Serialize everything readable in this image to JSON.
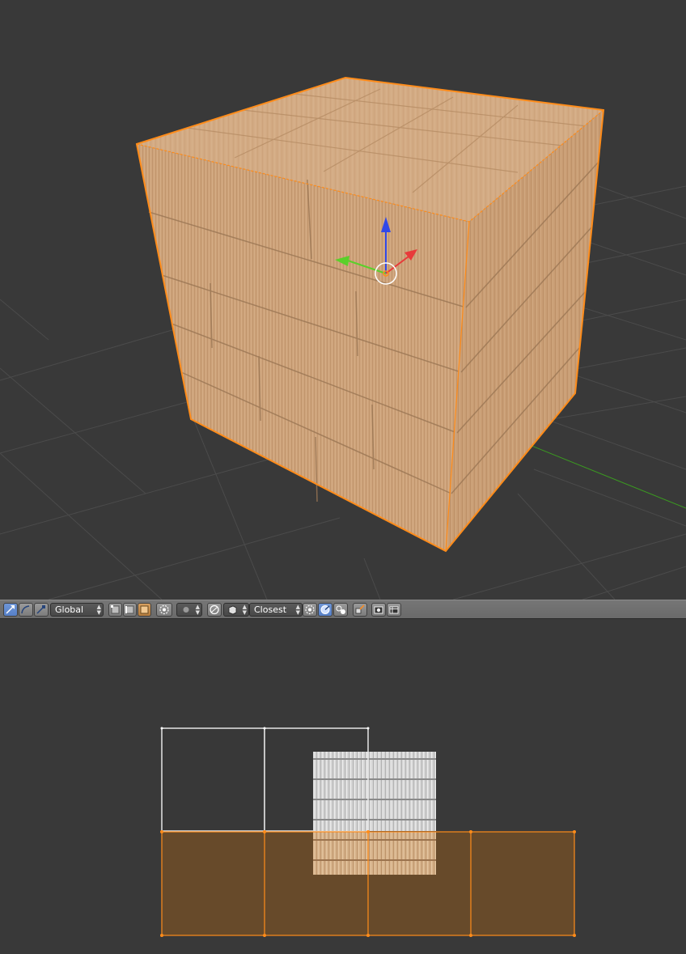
{
  "header": {
    "orientation_value": "Global",
    "snap_target_value": "Closest"
  },
  "icons": [
    "move-widget-icon",
    "rotate-widget-icon",
    "scale-widget-icon",
    "vertex-select-icon",
    "edge-select-icon",
    "face-select-icon",
    "limit-to-visible-icon",
    "pivot-icon",
    "proportional-edit-icon",
    "snap-icon",
    "snap-element-icon",
    "snap-target-icon",
    "align-rotation-icon",
    "snap-project-icon",
    "render-icon",
    "render-animation-icon"
  ],
  "colors": {
    "background": "#393939",
    "selection_outline": "#ff8c1a",
    "selected_face_fill": "#674a2a",
    "grid_line": "#4a4a4a",
    "axis_x": "#e83a3a",
    "axis_y": "#5ad02a",
    "axis_z": "#3048e8",
    "wood": "#cfa47c"
  }
}
